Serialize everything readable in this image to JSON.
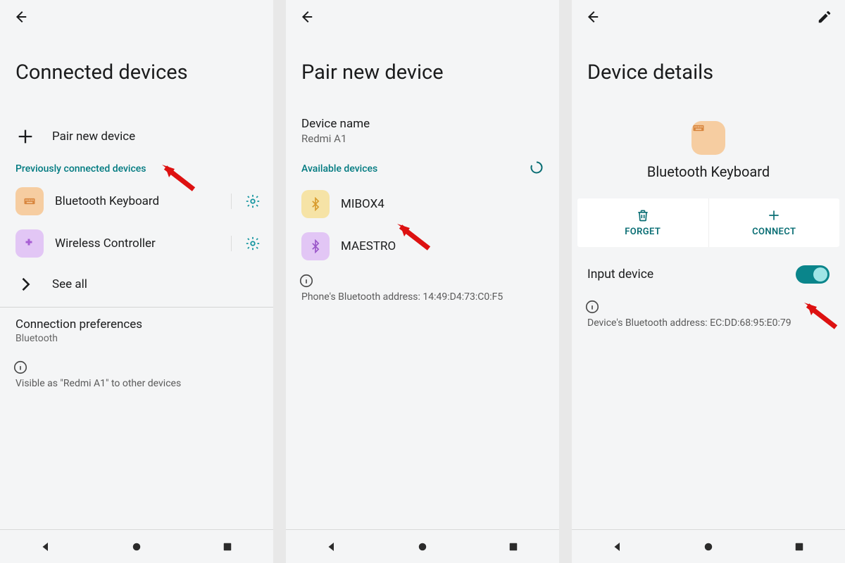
{
  "colors": {
    "accent": "#0a858b",
    "text": "#1b1c1d",
    "sub": "#616161"
  },
  "panel1": {
    "title": "Connected devices",
    "pair_label": "Pair new device",
    "prev_header": "Previously connected devices",
    "devices": [
      {
        "name": "Bluetooth Keyboard",
        "icon": "keyboard"
      },
      {
        "name": "Wireless Controller",
        "icon": "gamepad"
      }
    ],
    "see_all": "See all",
    "pref_title": "Connection preferences",
    "pref_sub": "Bluetooth",
    "visible_note": "Visible as \"Redmi A1\" to other devices"
  },
  "panel2": {
    "title": "Pair new device",
    "device_name_label": "Device name",
    "device_name_value": "Redmi A1",
    "available_header": "Available devices",
    "devices": [
      {
        "name": "MIBOX4",
        "icon": "bluetooth",
        "tint": "yellow"
      },
      {
        "name": "MAESTRO",
        "icon": "bluetooth",
        "tint": "purple"
      }
    ],
    "bt_addr": "Phone's Bluetooth address: 14:49:D4:73:C0:F5"
  },
  "panel3": {
    "title": "Device details",
    "device_name": "Bluetooth Keyboard",
    "forget_label": "FORGET",
    "connect_label": "CONNECT",
    "input_device_label": "Input device",
    "input_device_on": true,
    "bt_addr": "Device's Bluetooth address: EC:DD:68:95:E0:79"
  }
}
